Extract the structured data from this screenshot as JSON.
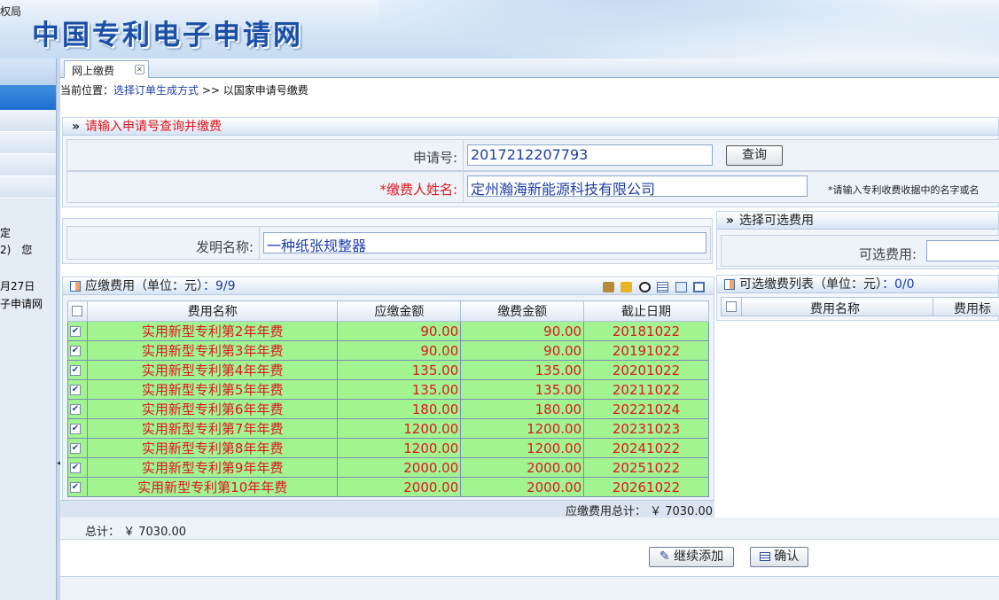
{
  "banner": {
    "org": "权局",
    "title": "中国专利电子申请网"
  },
  "leftnav": {
    "texts": [
      "定",
      "2)　您",
      "月27日",
      "子申请网"
    ]
  },
  "tab": {
    "label": "网上缴费"
  },
  "breadcrumb": {
    "prefix": "当前位置：",
    "link": "选择订单生成方式",
    "sep": " >> ",
    "current": "以国家申请号缴费"
  },
  "query": {
    "title": "请输入申请号查询并缴费",
    "app_no_label": "申请号:",
    "app_no_value": "2017212207793",
    "query_button": "查询",
    "payer_label": "*缴费人姓名:",
    "payer_value": "定州瀚海新能源科技有限公司",
    "payer_hint": "*请输入专利收费收据中的名字或名"
  },
  "invention": {
    "label": "发明名称:",
    "value": "一种纸张规整器"
  },
  "optional": {
    "title": "选择可选费用",
    "label": "可选费用:"
  },
  "payable": {
    "title": "应缴费用（单位：元）",
    "count": "：9/9",
    "columns": [
      "费用名称",
      "应缴金额",
      "缴费金额",
      "截止日期"
    ],
    "rows": [
      {
        "name": "实用新型专利第2年年费",
        "due": "90.00",
        "paid": "90.00",
        "deadline": "20181022"
      },
      {
        "name": "实用新型专利第3年年费",
        "due": "90.00",
        "paid": "90.00",
        "deadline": "20191022"
      },
      {
        "name": "实用新型专利第4年年费",
        "due": "135.00",
        "paid": "135.00",
        "deadline": "20201022"
      },
      {
        "name": "实用新型专利第5年年费",
        "due": "135.00",
        "paid": "135.00",
        "deadline": "20211022"
      },
      {
        "name": "实用新型专利第6年年费",
        "due": "180.00",
        "paid": "180.00",
        "deadline": "20221024"
      },
      {
        "name": "实用新型专利第7年年费",
        "due": "1200.00",
        "paid": "1200.00",
        "deadline": "20231023"
      },
      {
        "name": "实用新型专利第8年年费",
        "due": "1200.00",
        "paid": "1200.00",
        "deadline": "20241022"
      },
      {
        "name": "实用新型专利第9年年费",
        "due": "2000.00",
        "paid": "2000.00",
        "deadline": "20251022"
      },
      {
        "name": "实用新型专利第10年年费",
        "due": "2000.00",
        "paid": "2000.00",
        "deadline": "20261022"
      }
    ],
    "total_text": "应缴费用总计： ￥ 7030.00"
  },
  "optional_list": {
    "title": "可选缴费列表（单位：元）",
    "count": "：0/0",
    "columns": [
      "费用名称",
      "费用标"
    ]
  },
  "grand_total": "总计： ￥ 7030.00",
  "actions": {
    "continue": "继续添加",
    "confirm": "确认"
  }
}
